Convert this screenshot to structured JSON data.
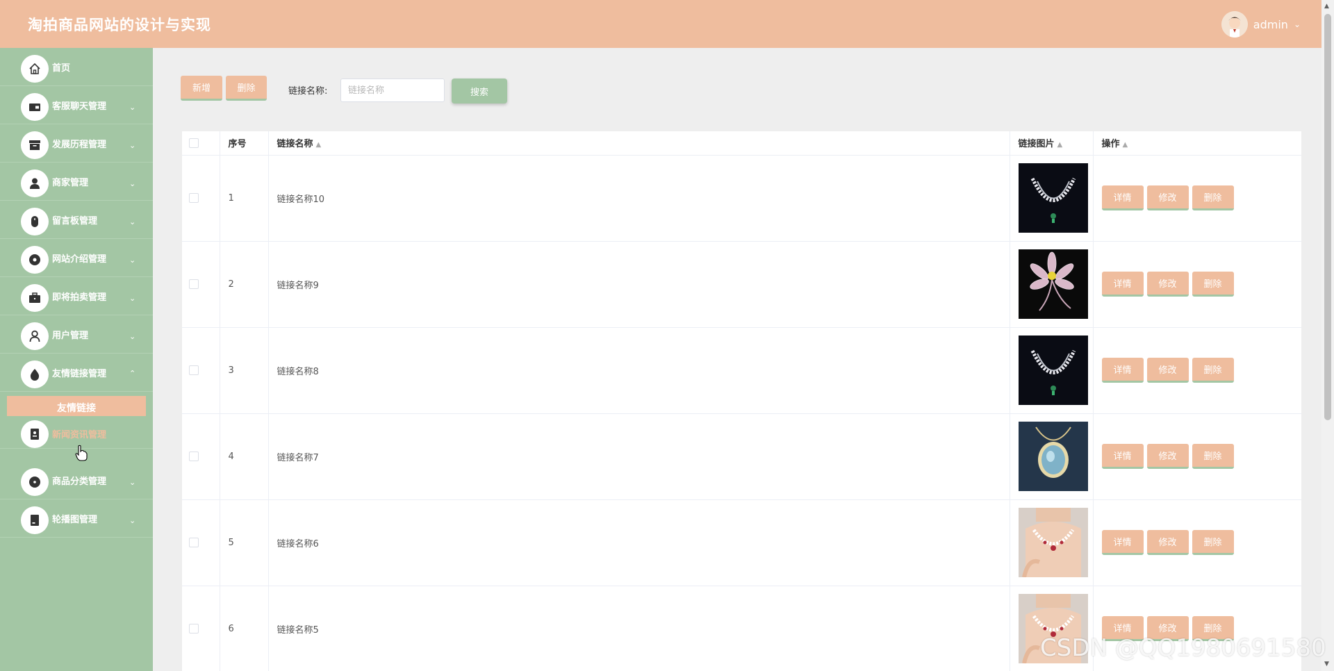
{
  "header": {
    "title": "淘拍商品网站的设计与实现",
    "username": "admin"
  },
  "sidebar": {
    "items": [
      {
        "label": "首页",
        "icon": "home-icon"
      },
      {
        "label": "客服聊天管理",
        "icon": "wallet-icon"
      },
      {
        "label": "发展历程管理",
        "icon": "archive-icon"
      },
      {
        "label": "商家管理",
        "icon": "person-icon"
      },
      {
        "label": "留言板管理",
        "icon": "mouse-icon"
      },
      {
        "label": "网站介绍管理",
        "icon": "disc-icon"
      },
      {
        "label": "即将拍卖管理",
        "icon": "briefcase-icon"
      },
      {
        "label": "用户管理",
        "icon": "user-outline-icon"
      },
      {
        "label": "友情链接管理",
        "icon": "drop-icon"
      },
      {
        "label": "新闻资讯管理",
        "icon": "contact-book-icon"
      },
      {
        "label": "商品分类管理",
        "icon": "target-icon"
      },
      {
        "label": "轮播图管理",
        "icon": "tablet-icon"
      }
    ],
    "submenu": {
      "label": "友情链接"
    }
  },
  "toolbar": {
    "add_label": "新增",
    "delete_label": "删除",
    "search_label": "链接名称:",
    "search_placeholder": "链接名称",
    "search_value": "",
    "search_button": "搜索"
  },
  "table": {
    "columns": [
      "序号",
      "链接名称",
      "链接图片",
      "操作"
    ],
    "rows": [
      {
        "no": "1",
        "name": "链接名称10",
        "image": "necklace-green-pendant"
      },
      {
        "no": "2",
        "name": "链接名称9",
        "image": "flower-brooch"
      },
      {
        "no": "3",
        "name": "链接名称8",
        "image": "necklace-green-pendant"
      },
      {
        "no": "4",
        "name": "链接名称7",
        "image": "blue-gem-pendant"
      },
      {
        "no": "5",
        "name": "链接名称6",
        "image": "model-necklace"
      },
      {
        "no": "6",
        "name": "链接名称5",
        "image": "model-necklace"
      }
    ],
    "actions": {
      "detail": "详情",
      "edit": "修改",
      "delete": "删除"
    }
  },
  "watermark": "CSDN @QQ1980691580",
  "colors": {
    "header_bg": "#efbd9e",
    "sidebar_bg": "#a3c6a4",
    "accent_peach": "#efbd9e",
    "accent_green": "#a3c6a4",
    "page_bg": "#eeeeee"
  }
}
